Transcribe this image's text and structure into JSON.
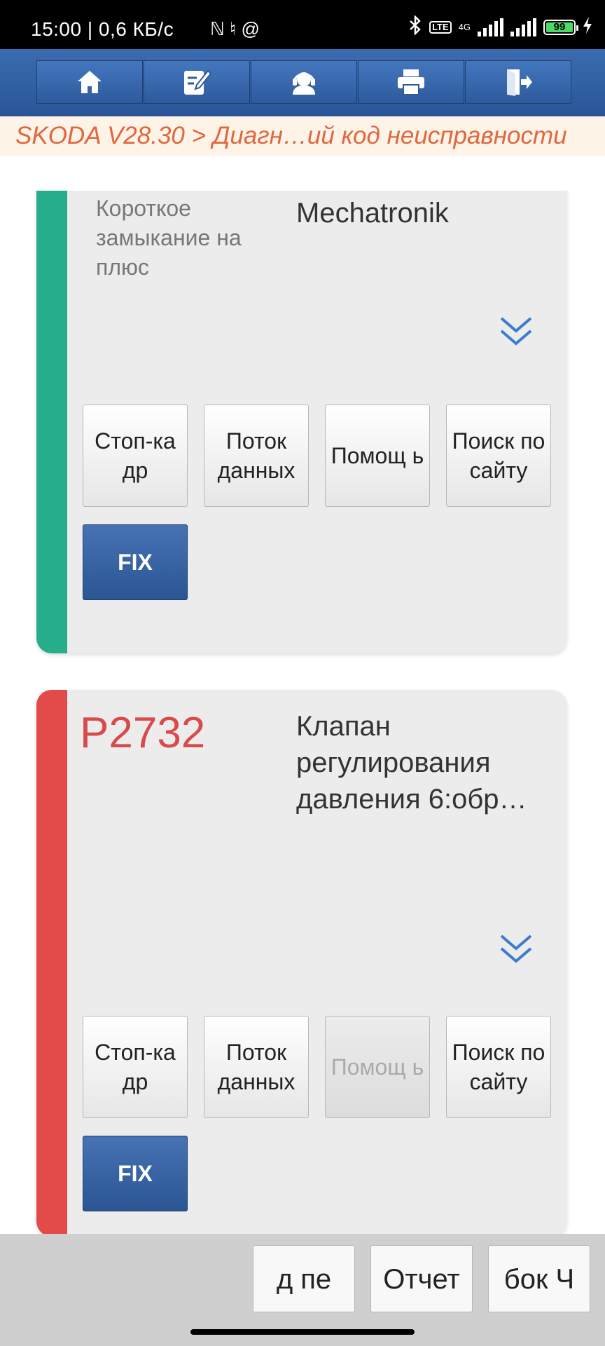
{
  "status_bar": {
    "time_speed": "15:00 | 0,6 КБ/с",
    "misc_icons": "ℕ ♮ @",
    "network_label": "4G",
    "volte_label": "LTE",
    "battery_level": "99"
  },
  "toolbar": {
    "items": [
      {
        "icon": "home-icon"
      },
      {
        "icon": "edit-icon"
      },
      {
        "icon": "support-icon"
      },
      {
        "icon": "print-icon"
      },
      {
        "icon": "exit-icon"
      }
    ]
  },
  "breadcrumb": {
    "text": "SKODA V28.30 > Диагн…ий код неисправности"
  },
  "cards": [
    {
      "stripe_color": "#26ad8a",
      "code": "",
      "status": "Короткое замыкание на плюс",
      "description": "Mechatronik",
      "buttons": [
        "Стоп-ка др",
        "Поток данных",
        "Помощ ь",
        "Поиск по сайту"
      ],
      "buttons_disabled": [
        false,
        false,
        false,
        false
      ],
      "fix_label": "FIX"
    },
    {
      "stripe_color": "#e34a4a",
      "code": "P2732",
      "status": "",
      "description": "Клапан регулирования давления 6:обр…",
      "buttons": [
        "Стоп-ка др",
        "Поток данных",
        "Помощ ь",
        "Поиск по сайту"
      ],
      "buttons_disabled": [
        false,
        false,
        true,
        false
      ],
      "fix_label": "FIX"
    }
  ],
  "bottom_bar": {
    "buttons": [
      "д пе",
      "Отчет",
      "бок Ч"
    ]
  }
}
